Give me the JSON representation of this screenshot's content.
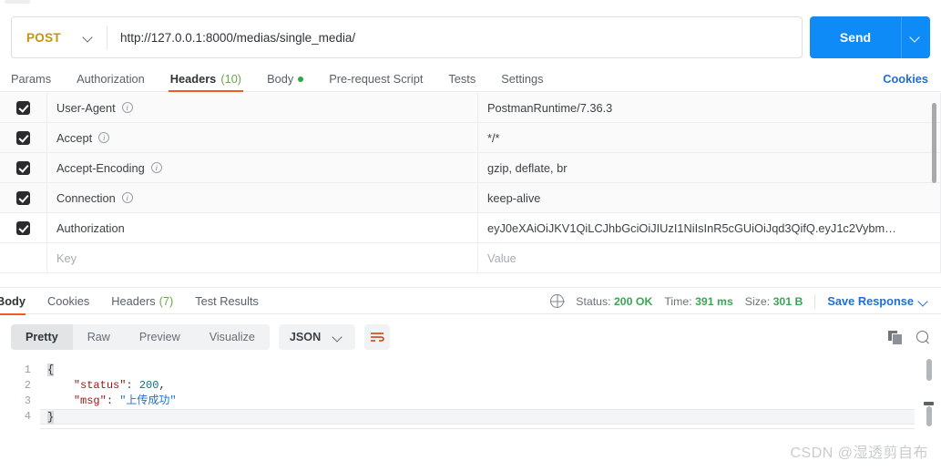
{
  "request": {
    "method": "POST",
    "url": "http://127.0.0.1:8000/medias/single_media/",
    "send_label": "Send",
    "tabs": [
      {
        "label": "Params",
        "active": false
      },
      {
        "label": "Authorization",
        "active": false
      },
      {
        "label": "Headers",
        "count": "(10)",
        "active": true
      },
      {
        "label": "Body",
        "dot": true,
        "active": false
      },
      {
        "label": "Pre-request Script",
        "active": false
      },
      {
        "label": "Tests",
        "active": false
      },
      {
        "label": "Settings",
        "active": false
      }
    ],
    "cookies_label": "Cookies"
  },
  "headers_table": {
    "placeholder_key": "Key",
    "placeholder_value": "Value",
    "rows": [
      {
        "checked": true,
        "key": "User-Agent",
        "info": true,
        "value": "PostmanRuntime/7.36.3"
      },
      {
        "checked": true,
        "key": "Accept",
        "info": true,
        "value": "*/*"
      },
      {
        "checked": true,
        "key": "Accept-Encoding",
        "info": true,
        "value": "gzip, deflate, br"
      },
      {
        "checked": true,
        "key": "Connection",
        "info": true,
        "value": "keep-alive"
      },
      {
        "checked": true,
        "key": "Authorization",
        "info": false,
        "value": "eyJ0eXAiOiJKV1QiLCJhbGciOiJIUzI1NiIsInR5cGUiOiJqd3QifQ.eyJ1c2Vybm…"
      }
    ]
  },
  "response": {
    "tabs": [
      {
        "label": "Body",
        "active": true
      },
      {
        "label": "Cookies",
        "active": false
      },
      {
        "label": "Headers",
        "count": "(7)",
        "active": false
      },
      {
        "label": "Test Results",
        "active": false
      }
    ],
    "status_label": "Status:",
    "status_value": "200 OK",
    "time_label": "Time:",
    "time_value": "391 ms",
    "size_label": "Size:",
    "size_value": "301 B",
    "save_response": "Save Response",
    "view_modes": [
      {
        "label": "Pretty",
        "active": true
      },
      {
        "label": "Raw",
        "active": false
      },
      {
        "label": "Preview",
        "active": false
      },
      {
        "label": "Visualize",
        "active": false
      }
    ],
    "format": "JSON",
    "body_lines": [
      {
        "n": "1",
        "open_brace": "{"
      },
      {
        "n": "2",
        "indent": "    ",
        "key": "\"status\"",
        "colon": ": ",
        "num": "200",
        "tail": ","
      },
      {
        "n": "3",
        "indent": "    ",
        "key": "\"msg\"",
        "colon": ": ",
        "str": "\"上传成功\"",
        "tail": ""
      },
      {
        "n": "4",
        "close_brace": "}"
      }
    ]
  },
  "watermark": "CSDN @湿透剪自布",
  "colors": {
    "method": "#c9930a",
    "send": "#0f8bf7",
    "accent": "#ef5b25",
    "link": "#1f6fd0",
    "ok": "#3aa655"
  }
}
